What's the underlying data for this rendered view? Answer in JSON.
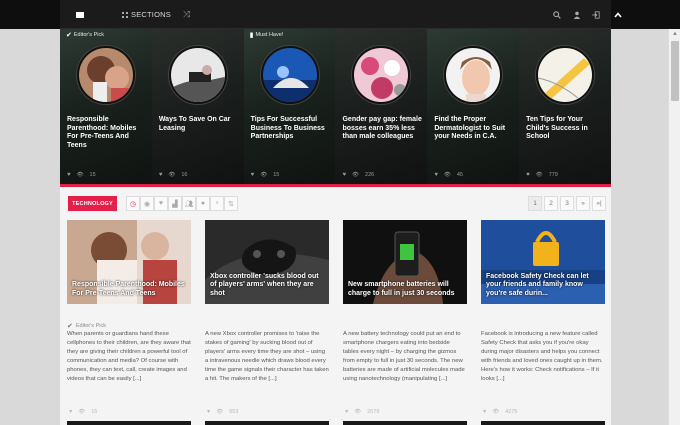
{
  "topbar": {
    "sections_label": "SECTIONS"
  },
  "featured": [
    {
      "badge": "Editor's Pick",
      "title": "Responsible Parenthood: Mobiles For Pre-Teens And Teens",
      "views": "15"
    },
    {
      "badge": "",
      "title": "Ways To Save On Car Leasing",
      "views": "16"
    },
    {
      "badge": "Must Have!",
      "title": "Tips For Successful Business To Business Partnerships",
      "views": "15"
    },
    {
      "badge": "",
      "title": "Gender pay gap: female bosses earn 35% less than male colleagues",
      "views": "226"
    },
    {
      "badge": "",
      "title": "Find the Proper Dermatologist to Suit your Needs in C.A.",
      "views": "45"
    },
    {
      "badge": "",
      "title": "Ten Tips for Your Child's Success in School",
      "views": "779"
    }
  ],
  "techbar": {
    "category": "TECHNOLOGY",
    "pages": [
      "1",
      "2",
      "3"
    ],
    "next": "»",
    "last": "»|"
  },
  "cards": [
    {
      "title": "Responsible Parenthood: Mobiles For Pre-Teens And Teens",
      "editor": "Editor's Pick",
      "excerpt": "When parents or guardians hand these cellphones to their children, are they aware that they are giving their children a powerful tool of communication and media? Of course with phones, they can text, call, create images and videos that can be easily [...]",
      "views": "15"
    },
    {
      "title": "Xbox controller 'sucks blood out of players' arms' when they are shot",
      "editor": "",
      "excerpt": "A new Xbox controller promises to 'raise the stakes of gaming' by sucking blood out of players' arms every time they are shot – using a intravenous needle which draws blood every time the game signals their character has taken a hit. The makers of the [...]",
      "views": "653"
    },
    {
      "title": "New smartphone batteries will charge to full in just 30 seconds",
      "editor": "",
      "excerpt": "A new battery technology could put an end to smartphone chargers eating into bedside tables every night – by charging the gizmos from empty to full in just 30 seconds. The new batteries are made of artificial molecules made using nanotechnology (manipulating [...]",
      "views": "2079"
    },
    {
      "title": "Facebook Safety Check can let your friends and family know you're safe durin...",
      "editor": "",
      "excerpt": "Facebook is introducing a new feature called Safety Check that asks you if you're okay during major disasters and helps you connect with friends and loved ones caught up in them. Here's how it works: Check notifications – If it looks [...]",
      "views": "4275"
    }
  ]
}
